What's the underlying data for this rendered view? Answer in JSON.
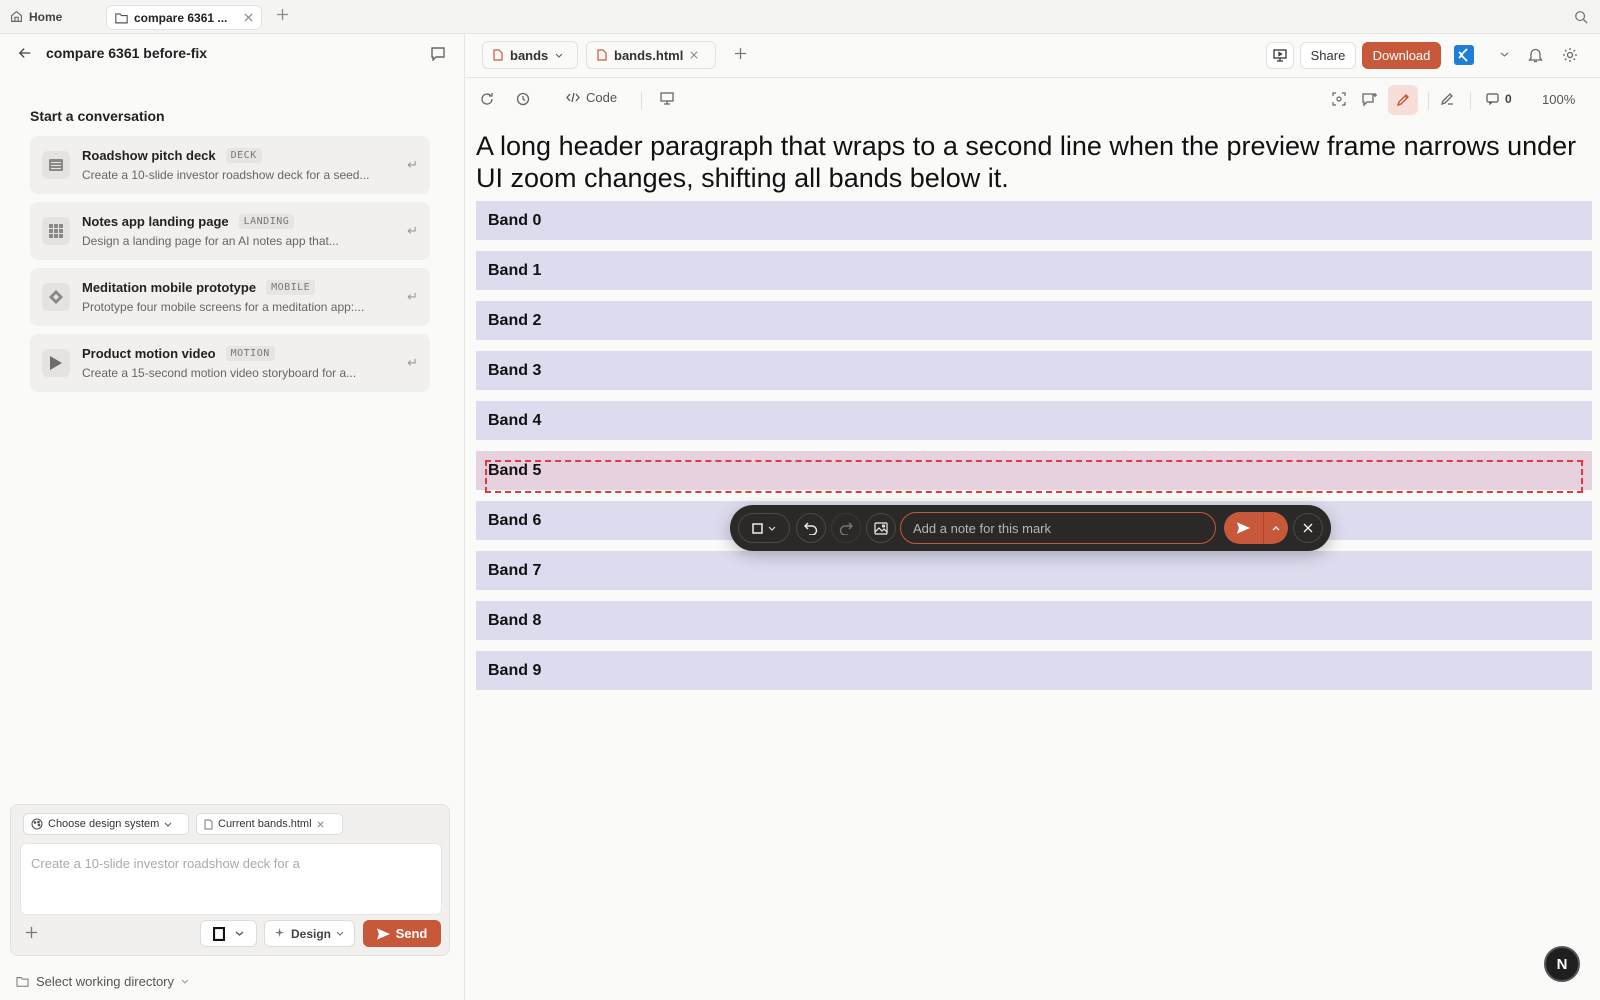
{
  "topbar": {
    "home_label": "Home",
    "tab_title": "compare 6361 ..."
  },
  "left": {
    "title": "compare 6361 before-fix",
    "conversation_heading": "Start a conversation",
    "cards": [
      {
        "name": "Roadshow pitch deck",
        "tag": "DECK",
        "desc": "Create a 10-slide investor roadshow deck for a seed..."
      },
      {
        "name": "Notes app landing page",
        "tag": "LANDING",
        "desc": "Design a landing page for an AI notes app that..."
      },
      {
        "name": "Meditation mobile prototype",
        "tag": "MOBILE",
        "desc": "Prototype four mobile screens for a meditation app:..."
      },
      {
        "name": "Product motion video",
        "tag": "MOTION",
        "desc": "Create a 15-second motion video storyboard for a..."
      }
    ],
    "composer": {
      "design_system_label": "Choose design system",
      "current_file_label": "Current bands.html",
      "placeholder": "Create a 10-slide investor roadshow deck for a",
      "design_label": "Design",
      "send_label": "Send"
    },
    "workdir_label": "Select working directory"
  },
  "right": {
    "filetabs": [
      {
        "label": "bands"
      },
      {
        "label": "bands.html"
      }
    ],
    "share_label": "Share",
    "download_label": "Download",
    "code_label": "Code",
    "comment_count": "0",
    "zoom": "100%"
  },
  "preview": {
    "paragraph": "A long header paragraph that wraps to a second line when the preview frame narrows under UI zoom changes, shifting all bands below it.",
    "bands": [
      "Band 0",
      "Band 1",
      "Band 2",
      "Band 3",
      "Band 4",
      "Band 5",
      "Band 6",
      "Band 7",
      "Band 8",
      "Band 9"
    ],
    "marked_band_index": 5
  },
  "annotation": {
    "placeholder": "Add a note for this mark"
  },
  "avatar_letter": "N",
  "colors": {
    "accent": "#c8583a",
    "band": "#dcdcee",
    "mark": "#e0393e"
  }
}
